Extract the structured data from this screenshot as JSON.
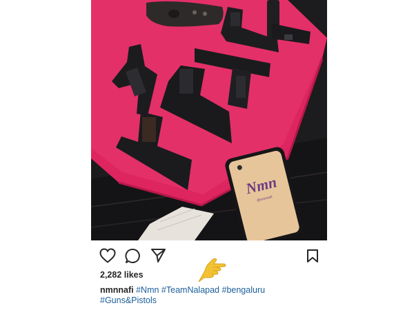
{
  "post": {
    "photo_alt": "Several handguns laid out on a pink towel beside a phone",
    "phone_case_text": "Nmn",
    "phone_case_subtext": "@nmnnafi",
    "likes": "2,282 likes",
    "caption": {
      "username": "nmnnafi",
      "hashtags": [
        "#Nmn",
        "#TeamNalapad",
        "#bengaluru",
        "#Guns&Pistols"
      ]
    },
    "annotation": "pointing-hand-emoji"
  },
  "icons": {
    "like": "heart-icon",
    "comment": "comment-icon",
    "share": "send-icon",
    "save": "bookmark-icon"
  },
  "colors": {
    "towel": "#e3245e",
    "text": "#262626",
    "hashtag": "#1a5e9a",
    "emoji": "#f2c232"
  }
}
